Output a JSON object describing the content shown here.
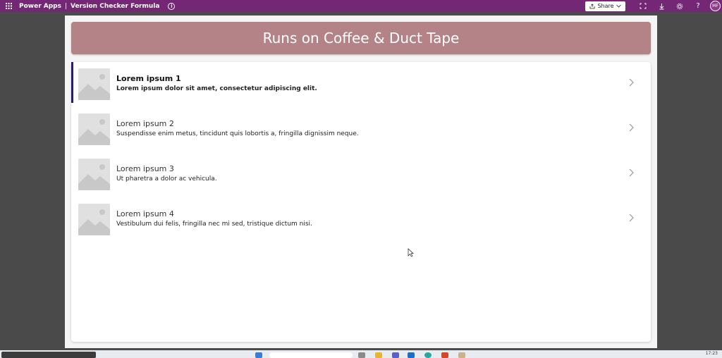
{
  "topbar": {
    "app_name": "Power Apps",
    "separator": "|",
    "app_title": "Version Checker Formula",
    "share_label": "Share",
    "avatar_initials": "MF",
    "background_color": "#742774"
  },
  "app": {
    "header_title": "Runs on Coffee & Duct Tape",
    "header_color": "#b38387",
    "items": [
      {
        "title": "Lorem ipsum 1",
        "subtitle": "Lorem ipsum dolor sit amet, consectetur adipiscing elit.",
        "selected": true
      },
      {
        "title": "Lorem ipsum 2",
        "subtitle": "Suspendisse enim metus, tincidunt quis lobortis a, fringilla dignissim neque.",
        "selected": false
      },
      {
        "title": "Lorem ipsum 3",
        "subtitle": "Ut pharetra a dolor ac vehicula.",
        "selected": false
      },
      {
        "title": "Lorem ipsum 4",
        "subtitle": "Vestibulum dui felis, fringilla nec mi sed, tristique dictum nisi.",
        "selected": false
      }
    ]
  },
  "taskbar": {
    "time": "17:23"
  }
}
